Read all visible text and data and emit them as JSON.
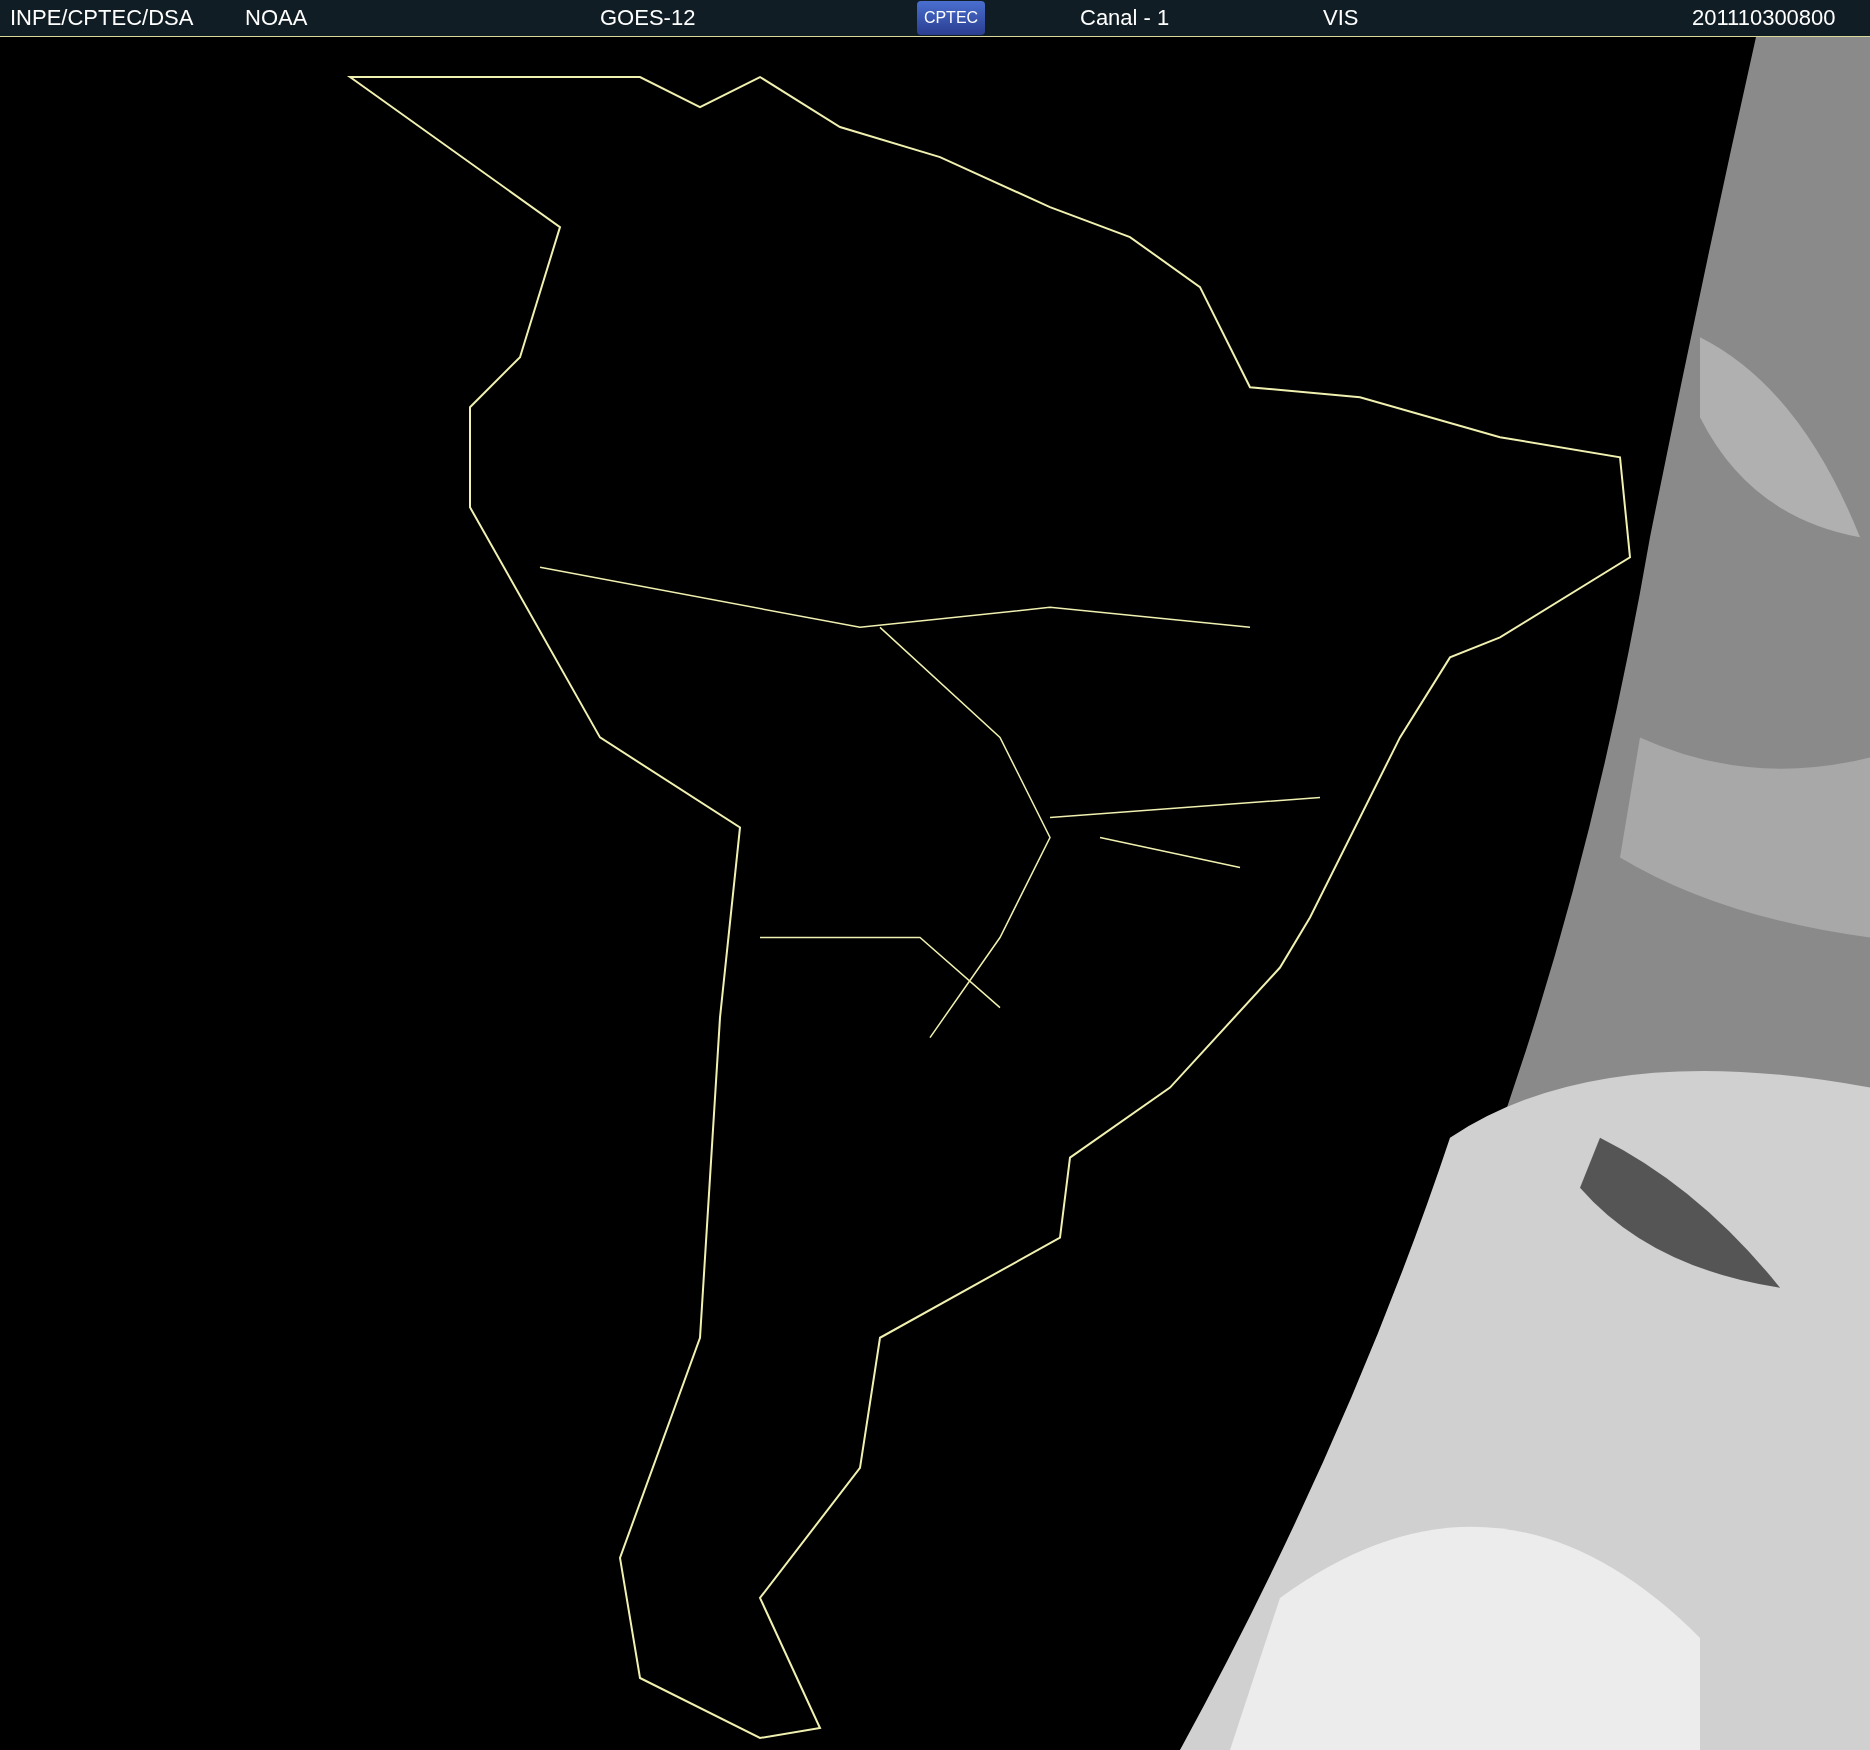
{
  "header": {
    "source": "INPE/CPTEC/DSA",
    "agency": "NOAA",
    "satellite": "GOES-12",
    "logo": "CPTEC",
    "channel": "Canal - 1",
    "band": "VIS",
    "timestamp": "201110300800"
  }
}
